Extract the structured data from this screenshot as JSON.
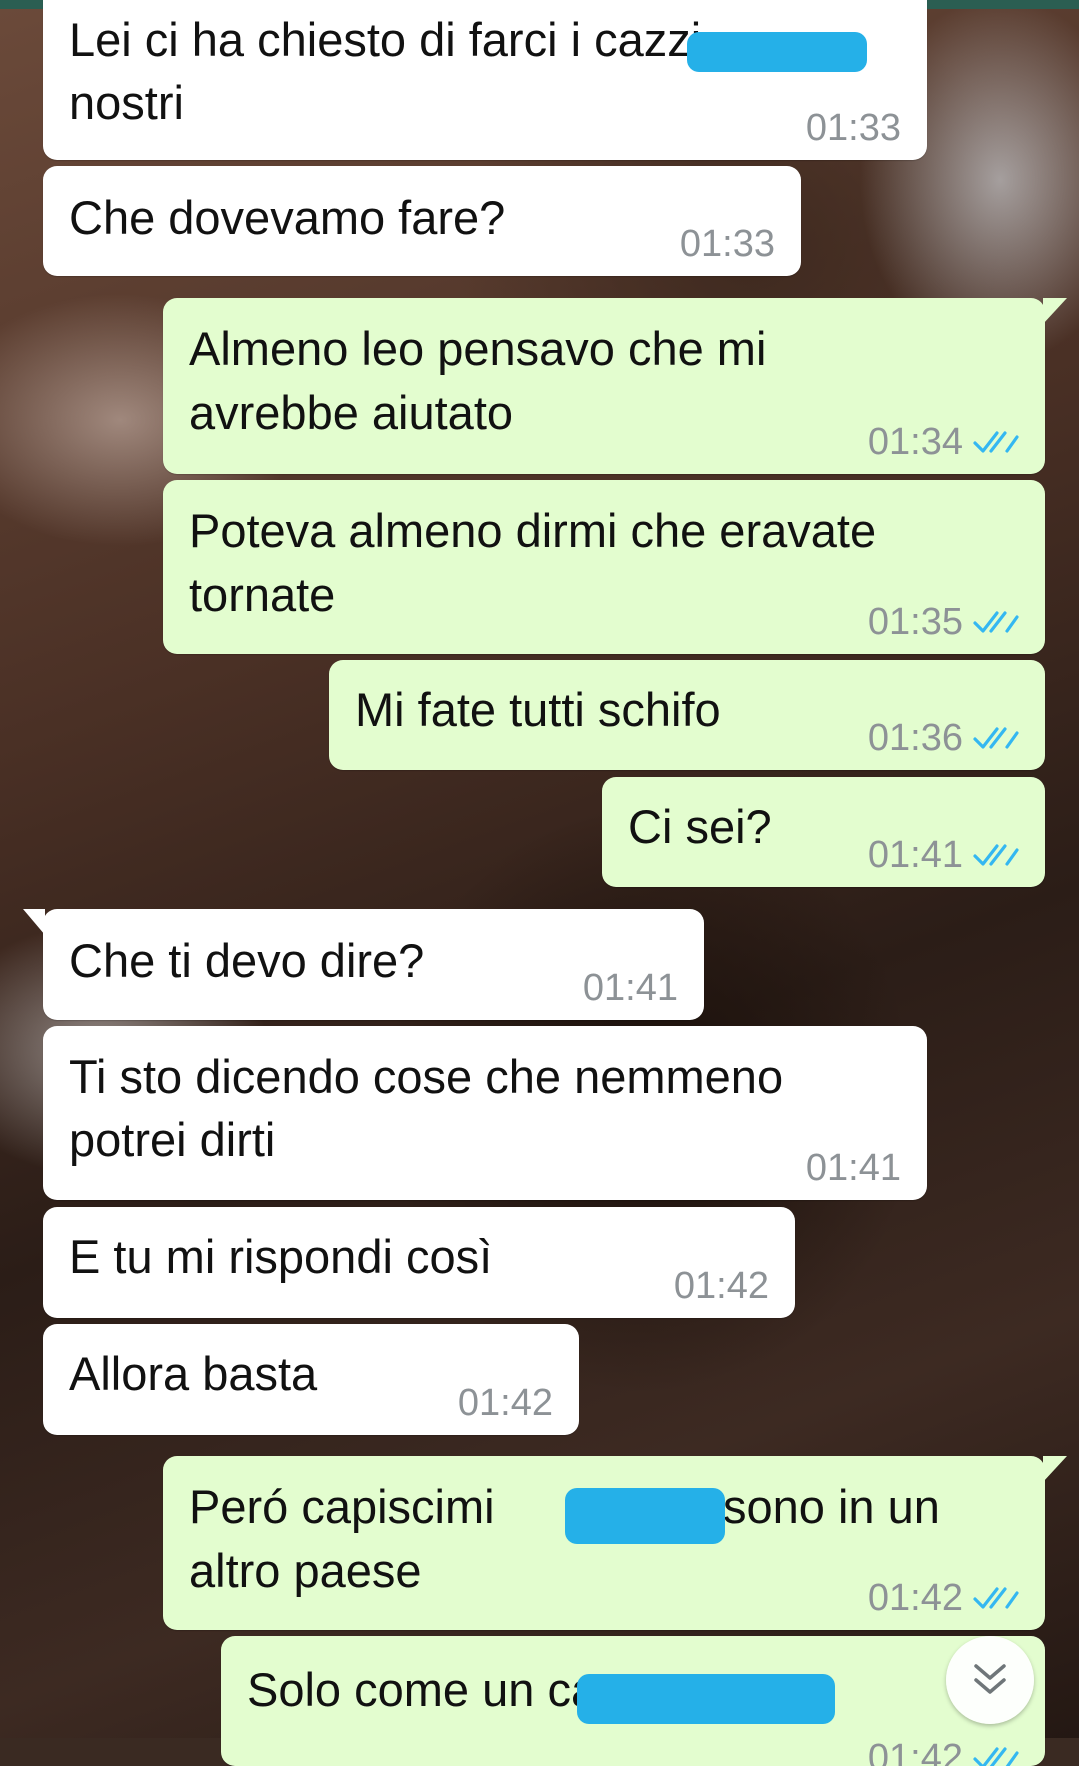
{
  "chat": {
    "messages": [
      {
        "direction": "in",
        "lines": [
          "Lei ci ha chiesto di farci i cazzi",
          "nostri"
        ],
        "time": "01:33"
      },
      {
        "direction": "in",
        "lines": [
          "Che dovevamo fare?"
        ],
        "time": "01:33"
      },
      {
        "direction": "out",
        "lines": [
          "Almeno leo pensavo che mi",
          "avrebbe aiutato"
        ],
        "time": "01:34",
        "status": "read"
      },
      {
        "direction": "out",
        "lines": [
          "Poteva almeno dirmi che eravate",
          "tornate"
        ],
        "time": "01:35",
        "status": "read"
      },
      {
        "direction": "out",
        "lines": [
          "Mi fate tutti schifo"
        ],
        "time": "01:36",
        "status": "read"
      },
      {
        "direction": "out",
        "lines": [
          "Ci sei?"
        ],
        "time": "01:41",
        "status": "read"
      },
      {
        "direction": "in",
        "lines": [
          "Che ti devo dire?"
        ],
        "time": "01:41"
      },
      {
        "direction": "in",
        "lines": [
          "Ti sto dicendo cose che nemmeno",
          "potrei dirti"
        ],
        "time": "01:41"
      },
      {
        "direction": "in",
        "lines": [
          "E tu mi rispondi così"
        ],
        "time": "01:42"
      },
      {
        "direction": "in",
        "lines": [
          "Allora basta"
        ],
        "time": "01:42"
      },
      {
        "direction": "out",
        "lines": [
          "Peró capiscimi",
          "sono in un",
          "altro paese"
        ],
        "time": "01:42",
        "status": "read"
      },
      {
        "direction": "out",
        "lines": [
          "Solo come un cane"
        ],
        "time": "01:42",
        "status": "read"
      }
    ]
  },
  "icons": {
    "read_receipt": "double-check-icon",
    "scroll_down": "double-chevron-down-icon",
    "redaction": "redaction-mark"
  },
  "colors": {
    "incoming_bubble": "#ffffff",
    "outgoing_bubble": "#e3fdcf",
    "read_check": "#34b7f1",
    "timestamp": "#8d9296",
    "redaction": "#25b0e8",
    "top_strip": "#2b5e52"
  }
}
